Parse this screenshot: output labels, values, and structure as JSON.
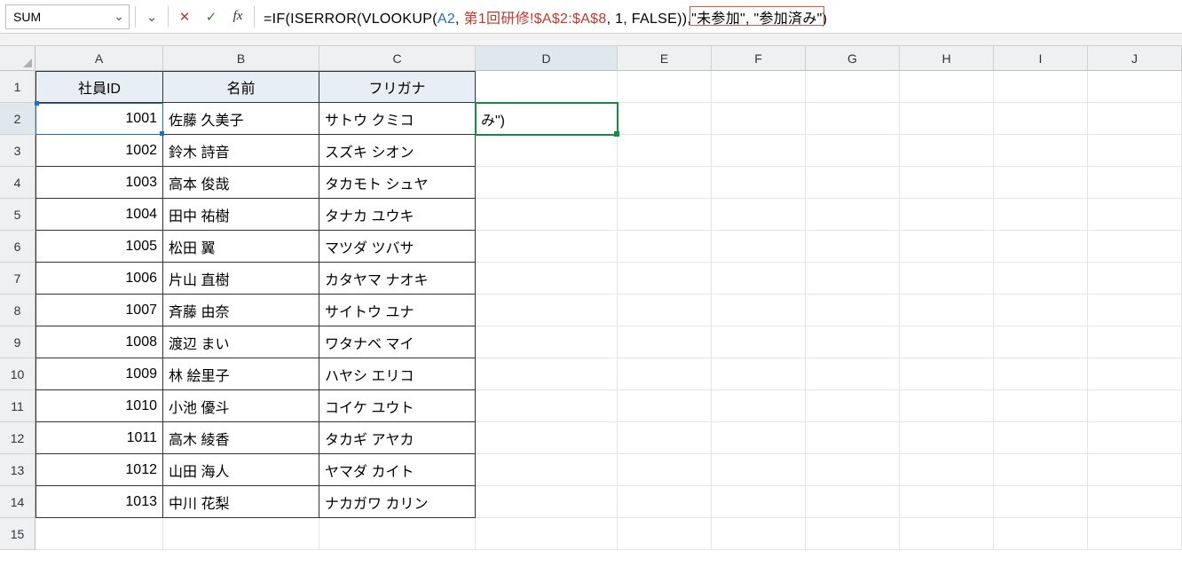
{
  "name_box": "SUM",
  "formula": {
    "prefix": "=",
    "fn_if": "IF",
    "open1": "(",
    "fn_iserror": "ISERROR",
    "open2": "(",
    "fn_vlookup": "VLOOKUP",
    "open3": "(",
    "arg_ref": "A2",
    "sep1": ", ",
    "arg_range": "第1回研修!$A$2:$A$8",
    "sep2": ", ",
    "arg_col": "1",
    "sep3": ", ",
    "arg_match": "FALSE",
    "close3": ")",
    "close2": ")",
    "sep4": ",",
    "arg_true": "\"未参加\"",
    "sep5": ", ",
    "arg_false": "\"参加済み\"",
    "close1": ")"
  },
  "columns": [
    "A",
    "B",
    "C",
    "D",
    "E",
    "F",
    "G",
    "H",
    "I",
    "J"
  ],
  "headers": {
    "A": "社員ID",
    "B": "名前",
    "C": "フリガナ"
  },
  "editing_cell_display": "み\")",
  "rows": [
    {
      "id": "1001",
      "name": "佐藤 久美子",
      "kana": "サトウ クミコ"
    },
    {
      "id": "1002",
      "name": "鈴木 詩音",
      "kana": "スズキ シオン"
    },
    {
      "id": "1003",
      "name": "高本 俊哉",
      "kana": "タカモト シュヤ"
    },
    {
      "id": "1004",
      "name": "田中 祐樹",
      "kana": "タナカ ユウキ"
    },
    {
      "id": "1005",
      "name": "松田 翼",
      "kana": "マツダ ツバサ"
    },
    {
      "id": "1006",
      "name": "片山 直樹",
      "kana": "カタヤマ ナオキ"
    },
    {
      "id": "1007",
      "name": "斉藤 由奈",
      "kana": "サイトウ ユナ"
    },
    {
      "id": "1008",
      "name": "渡辺 まい",
      "kana": "ワタナベ マイ"
    },
    {
      "id": "1009",
      "name": "林 絵里子",
      "kana": "ハヤシ エリコ"
    },
    {
      "id": "1010",
      "name": "小池 優斗",
      "kana": "コイケ ユウト"
    },
    {
      "id": "1011",
      "name": "高木 綾香",
      "kana": "タカギ アヤカ"
    },
    {
      "id": "1012",
      "name": "山田 海人",
      "kana": "ヤマダ カイト"
    },
    {
      "id": "1013",
      "name": "中川 花梨",
      "kana": "ナカガワ カリン"
    }
  ],
  "row_numbers": [
    "1",
    "2",
    "3",
    "4",
    "5",
    "6",
    "7",
    "8",
    "9",
    "10",
    "11",
    "12",
    "13",
    "14",
    "15"
  ],
  "icons": {
    "dropdown": "⌄",
    "cancel": "✕",
    "enter": "✓",
    "fx": "fx",
    "expand": "⌄"
  }
}
